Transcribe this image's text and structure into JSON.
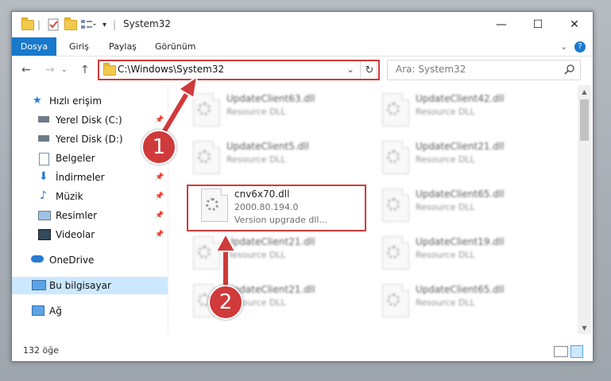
{
  "window": {
    "title": "System32",
    "controls": {
      "minimize": "—",
      "maximize": "☐",
      "close": "✕"
    }
  },
  "ribbon": {
    "tabs": [
      "Dosya",
      "Giriş",
      "Paylaş",
      "Görünüm"
    ],
    "expand_icon": "chevron-down-icon",
    "help_icon": "?"
  },
  "address": {
    "path": "C:\\Windows\\System32",
    "search_placeholder": "Ara: System32"
  },
  "sidebar": {
    "items": [
      {
        "label": "Hızlı erişim",
        "icon": "star-icon",
        "pinned": false
      },
      {
        "label": "Yerel Disk (C:)",
        "icon": "drive-icon",
        "pinned": true
      },
      {
        "label": "Yerel Disk (D:)",
        "icon": "drive-icon",
        "pinned": true
      },
      {
        "label": "Belgeler",
        "icon": "document-icon",
        "pinned": true
      },
      {
        "label": "İndirmeler",
        "icon": "download-icon",
        "pinned": true
      },
      {
        "label": "Müzik",
        "icon": "music-icon",
        "pinned": true
      },
      {
        "label": "Resimler",
        "icon": "picture-icon",
        "pinned": true
      },
      {
        "label": "Videolar",
        "icon": "video-icon",
        "pinned": true
      },
      {
        "label": "OneDrive",
        "icon": "cloud-icon",
        "pinned": false
      },
      {
        "label": "Bu bilgisayar",
        "icon": "computer-icon",
        "pinned": false,
        "selected": true
      },
      {
        "label": "Ağ",
        "icon": "network-icon",
        "pinned": false
      }
    ]
  },
  "files": [
    {
      "name": "UpdateClient63.dll",
      "type": "Resource DLL"
    },
    {
      "name": "UpdateClient42.dll",
      "type": "Resource DLL"
    },
    {
      "name": "UpdateClient5.dll",
      "type": "Resource DLL"
    },
    {
      "name": "UpdateClient21.dll",
      "type": "Resource DLL"
    },
    {
      "name": "cnv6x70.dll",
      "version": "2000.80.194.0",
      "type": "Version upgrade dll...",
      "highlighted": true
    },
    {
      "name": "UpdateClient65.dll",
      "type": "Resource DLL"
    },
    {
      "name": "UpdateClient21.dll",
      "type": "Resource DLL"
    },
    {
      "name": "UpdateClient19.dll",
      "type": "Resource DLL"
    },
    {
      "name": "UpdateClient21.dll",
      "type": "Resource DLL"
    },
    {
      "name": "UpdateClient65.dll",
      "type": "Resource DLL"
    }
  ],
  "status": {
    "item_count": "132 öğe"
  },
  "annotations": {
    "step1": "1",
    "step2": "2",
    "color": "#d03a3a"
  },
  "colors": {
    "accent": "#1979ca",
    "selected": "#cce8ff"
  }
}
